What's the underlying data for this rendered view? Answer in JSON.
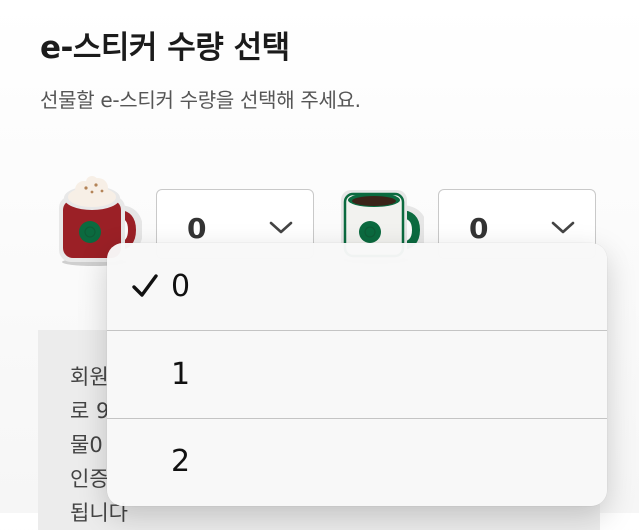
{
  "header": {
    "title": "e-스티커 수량 선택",
    "subtitle": "선물할 e-스티커 수량을 선택해 주세요."
  },
  "stickers": [
    {
      "icon": "red-holiday-mug-icon",
      "quantity": "0"
    },
    {
      "icon": "green-coffee-mug-icon",
      "quantity": "0"
    }
  ],
  "info": {
    "text": "회원\n로 9\n물0\n인증\n됩니다"
  },
  "dropdown": {
    "selected": "0",
    "options": [
      "0",
      "1",
      "2"
    ]
  },
  "colors": {
    "mug_red": "#9b2026",
    "mug_green": "#0b6a3f",
    "mug_white": "#f2f2ef",
    "coffee": "#3b2318"
  }
}
